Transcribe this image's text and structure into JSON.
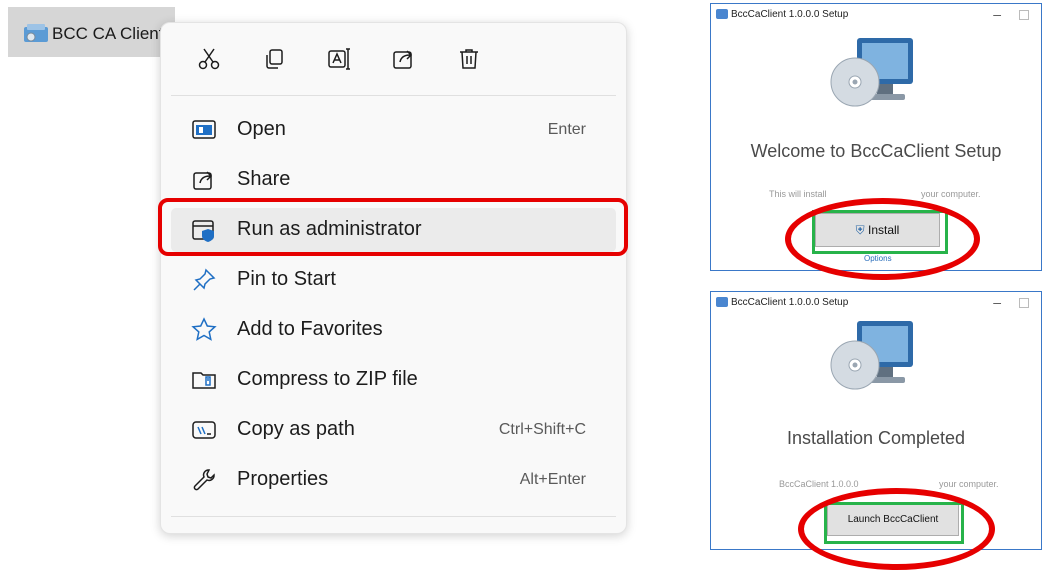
{
  "desktop": {
    "file_label": "BCC CA Client"
  },
  "context_menu": {
    "toolbar": [
      {
        "icon": "cut-icon",
        "label": "Cut"
      },
      {
        "icon": "copy-icon",
        "label": "Copy"
      },
      {
        "icon": "rename-icon",
        "label": "Rename"
      },
      {
        "icon": "share-icon",
        "label": "Share"
      },
      {
        "icon": "delete-icon",
        "label": "Delete"
      }
    ],
    "items": [
      {
        "label": "Open",
        "shortcut": "Enter",
        "icon": "open-icon"
      },
      {
        "label": "Share",
        "shortcut": "",
        "icon": "share-icon"
      },
      {
        "label": "Run as administrator",
        "shortcut": "",
        "icon": "run-as-admin-icon",
        "highlighted": true
      },
      {
        "label": "Pin to Start",
        "shortcut": "",
        "icon": "pin-icon"
      },
      {
        "label": "Add to Favorites",
        "shortcut": "",
        "icon": "star-icon"
      },
      {
        "label": "Compress to ZIP file",
        "shortcut": "",
        "icon": "zip-icon"
      },
      {
        "label": "Copy as path",
        "shortcut": "Ctrl+Shift+C",
        "icon": "copy-path-icon"
      },
      {
        "label": "Properties",
        "shortcut": "Alt+Enter",
        "icon": "properties-icon"
      }
    ]
  },
  "installer_welcome": {
    "title": "BccCaClient 1.0.0.0 Setup",
    "heading": "Welcome to BccCaClient Setup",
    "subtext_left": "This will install",
    "subtext_right": "your computer.",
    "install_button": "Install",
    "options_link": "Options",
    "minimize": "–"
  },
  "installer_complete": {
    "title": "BccCaClient 1.0.0.0 Setup",
    "heading": "Installation Completed",
    "subtext_left": "BccCaClient 1.0.0.0",
    "subtext_right": "your computer.",
    "launch_button": "Launch BccCaClient",
    "minimize": "–"
  },
  "colors": {
    "highlight_red": "#e60000",
    "highlight_green": "#27b34a",
    "menu_bg": "#f9f9f9",
    "window_border": "#3a78c8"
  }
}
